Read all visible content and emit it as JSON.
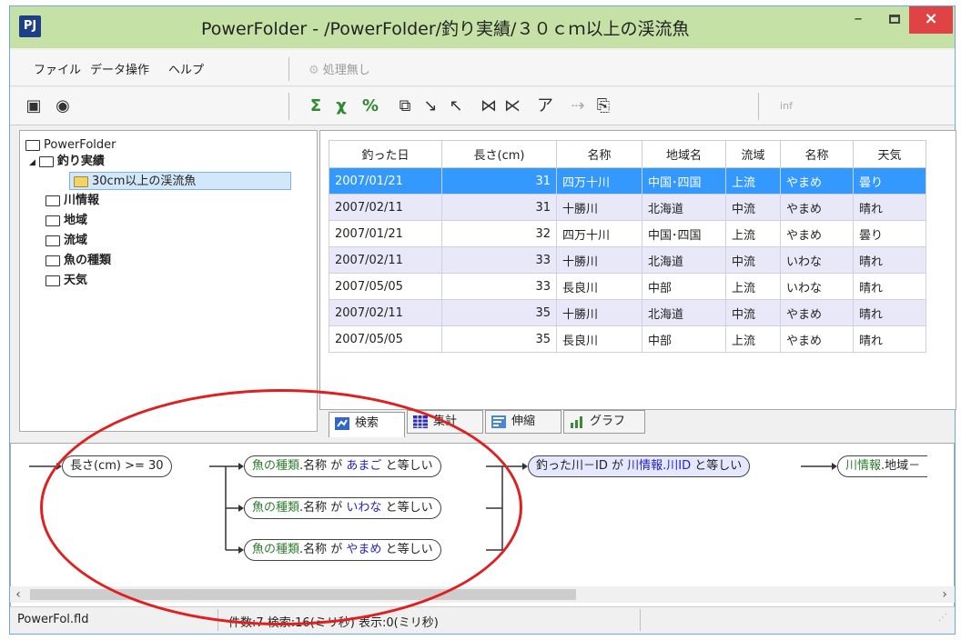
{
  "window": {
    "icon": "PJ",
    "title": "PowerFolder - /PowerFolder/釣り実績/３０ｃｍ以上の渓流魚",
    "controls": {
      "minimize": "–",
      "close": "×"
    }
  },
  "menu": {
    "items": [
      "ファイル",
      "データ操作",
      "ヘルプ"
    ],
    "processing": "処理無し"
  },
  "toolbar": {
    "left": [
      "image-icon",
      "eye-icon"
    ],
    "icons": [
      "sum-icon",
      "sum-cancel-icon",
      "percent-icon",
      "copy-icon",
      "sort-asc-icon",
      "sort-desc-icon",
      "filter-icon",
      "filter-clear-icon",
      "text-icon",
      "forward-icon",
      "export-icon"
    ],
    "info": "inf"
  },
  "tree": {
    "root": "PowerFolder",
    "items": [
      {
        "label": "釣り実績",
        "level": 1,
        "expanded": true
      },
      {
        "label": "30cm以上の渓流魚",
        "level": 2,
        "selected": true
      },
      {
        "label": "川情報",
        "level": 1
      },
      {
        "label": "地域",
        "level": 1
      },
      {
        "label": "流域",
        "level": 1
      },
      {
        "label": "魚の種類",
        "level": 1
      },
      {
        "label": "天気",
        "level": 1
      }
    ]
  },
  "grid": {
    "columns": [
      "釣った日",
      "長さ(cm)",
      "名称",
      "地域名",
      "流域",
      "名称",
      "天気"
    ],
    "rows": [
      [
        "2007/01/21",
        "31",
        "四万十川",
        "中国･四国",
        "上流",
        "やまめ",
        "曇り"
      ],
      [
        "2007/02/11",
        "31",
        "十勝川",
        "北海道",
        "中流",
        "やまめ",
        "晴れ"
      ],
      [
        "2007/01/21",
        "32",
        "四万十川",
        "中国･四国",
        "上流",
        "やまめ",
        "曇り"
      ],
      [
        "2007/02/11",
        "33",
        "十勝川",
        "北海道",
        "中流",
        "いわな",
        "晴れ"
      ],
      [
        "2007/05/05",
        "33",
        "長良川",
        "中部",
        "上流",
        "いわな",
        "晴れ"
      ],
      [
        "2007/02/11",
        "35",
        "十勝川",
        "北海道",
        "中流",
        "やまめ",
        "晴れ"
      ],
      [
        "2007/05/05",
        "35",
        "長良川",
        "中部",
        "上流",
        "やまめ",
        "晴れ"
      ]
    ],
    "selected_row": 0
  },
  "tabs": [
    {
      "label": "検索",
      "icon": "search-tab-icon",
      "active": true
    },
    {
      "label": "集計",
      "icon": "table-tab-icon"
    },
    {
      "label": "伸縮",
      "icon": "stretch-tab-icon"
    },
    {
      "label": "グラフ",
      "icon": "chart-tab-icon"
    }
  ],
  "query": {
    "condition_length": "長さ(cm) >= 30",
    "fish_conditions": [
      {
        "field": "魚の種類",
        "col": ".名称 が ",
        "value": "あまご",
        "op": " と等しい"
      },
      {
        "field": "魚の種類",
        "col": ".名称 が ",
        "value": "いわな",
        "op": " と等しい"
      },
      {
        "field": "魚の種類",
        "col": ".名称 が ",
        "value": "やまめ",
        "op": " と等しい"
      }
    ],
    "join": {
      "left": "釣った川－ID が ",
      "right": "川情報.川ID",
      "op": " と等しい"
    },
    "next": {
      "field": "川情報",
      "rest": ".地域－"
    },
    "highlight_color": "#e02020"
  },
  "status": {
    "file": "PowerFol.fld",
    "stats": "件数:7  検索:16(ミリ秒)  表示:0(ミリ秒)"
  }
}
